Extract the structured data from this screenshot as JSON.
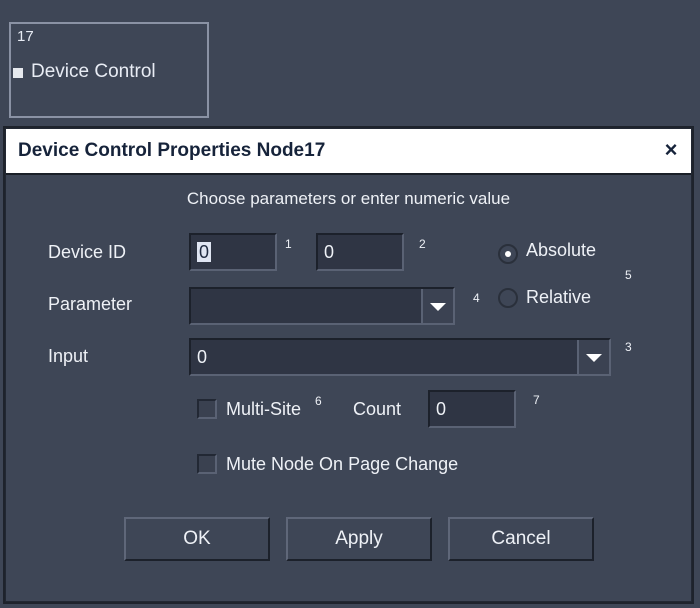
{
  "node": {
    "number": "17",
    "label": "Device Control"
  },
  "dialog": {
    "title": "Device Control Properties Node17",
    "close_label": "×",
    "instruction": "Choose parameters or enter numeric value",
    "device_id": {
      "label": "Device ID",
      "value1": "0",
      "value2": "0",
      "sup1": "1",
      "sup2": "2"
    },
    "mode": {
      "absolute_label": "Absolute",
      "relative_label": "Relative",
      "selected": "Absolute",
      "sup": "5"
    },
    "parameter": {
      "label": "Parameter",
      "value": "",
      "sup": "4"
    },
    "input": {
      "label": "Input",
      "value": "0",
      "sup": "3"
    },
    "multisite": {
      "label": "Multi-Site",
      "checked": false,
      "sup": "6"
    },
    "count": {
      "label": "Count",
      "value": "0",
      "sup": "7"
    },
    "mute": {
      "label": "Mute Node On Page Change",
      "checked": false
    },
    "buttons": {
      "ok": "OK",
      "apply": "Apply",
      "cancel": "Cancel"
    }
  }
}
